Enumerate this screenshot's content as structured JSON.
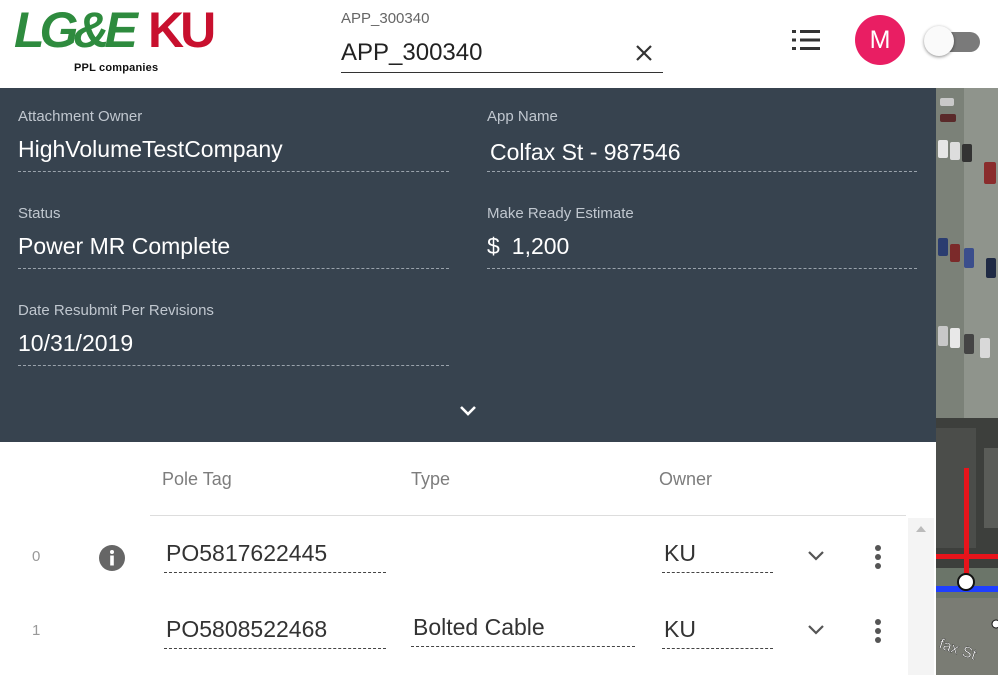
{
  "header": {
    "logo": {
      "brand_left": "LG&E",
      "brand_right": "KU",
      "subtitle": "PPL companies"
    },
    "search": {
      "label": "APP_300340",
      "value": "APP_300340"
    },
    "clear_icon": "close-icon",
    "list_icon": "list-icon",
    "avatar_initial": "M",
    "toggle_on": false
  },
  "details": {
    "attachment_owner": {
      "label": "Attachment Owner",
      "value": "HighVolumeTestCompany"
    },
    "app_name": {
      "label": "App Name",
      "value": "Colfax St - 987546"
    },
    "status": {
      "label": "Status",
      "value": "Power MR Complete"
    },
    "make_ready_estimate": {
      "label": "Make Ready Estimate",
      "currency": "$",
      "value": "1,200"
    },
    "date_resubmit": {
      "label": "Date Resubmit Per Revisions",
      "value": "10/31/2019"
    }
  },
  "table": {
    "columns": {
      "pole_tag": "Pole Tag",
      "type": "Type",
      "owner": "Owner"
    },
    "rows": [
      {
        "index": "0",
        "pole_tag": "PO5817622445",
        "type": "",
        "owner": "KU",
        "has_info": true
      },
      {
        "index": "1",
        "pole_tag": "PO5808522468",
        "type": "Bolted Cable",
        "owner": "KU",
        "has_info": false
      }
    ]
  },
  "map": {
    "street_label": "fax St"
  },
  "colors": {
    "panel_bg": "#37434f",
    "avatar": "#e91e63",
    "lge_green": "#2e8b3e",
    "ku_red": "#c8102e"
  }
}
